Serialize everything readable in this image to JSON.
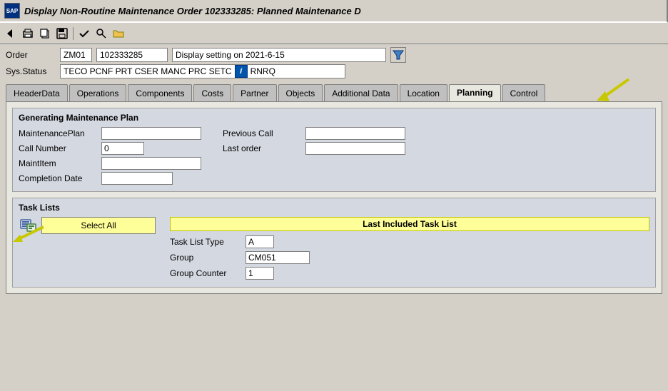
{
  "titlebar": {
    "title": "Display Non-Routine Maintenance Order 102333285: Planned Maintenance D",
    "icon_text": "SAP"
  },
  "toolbar": {
    "buttons": [
      "⬆",
      "🖨",
      "📋",
      "💾",
      "📂",
      "✂",
      "✔",
      "🔍"
    ]
  },
  "order": {
    "label": "Order",
    "type": "ZM01",
    "number": "102333285",
    "description": "Display setting on 2021-6-15"
  },
  "sys_status": {
    "label": "Sys.Status",
    "values": "TECO PCNF PRT   CSER MANC PRC   SETC",
    "extra": "RNRQ"
  },
  "tabs": [
    {
      "id": "headerdata",
      "label": "HeaderData"
    },
    {
      "id": "operations",
      "label": "Operations"
    },
    {
      "id": "components",
      "label": "Components"
    },
    {
      "id": "costs",
      "label": "Costs"
    },
    {
      "id": "partner",
      "label": "Partner"
    },
    {
      "id": "objects",
      "label": "Objects"
    },
    {
      "id": "additional-data",
      "label": "Additional Data"
    },
    {
      "id": "location",
      "label": "Location"
    },
    {
      "id": "planning",
      "label": "Planning"
    },
    {
      "id": "control",
      "label": "Control"
    }
  ],
  "active_tab": "planning",
  "planning": {
    "generating_section": {
      "title": "Generating Maintenance Plan",
      "fields_left": [
        {
          "label": "MaintenancePlan",
          "value": ""
        },
        {
          "label": "Call Number",
          "value": "0"
        },
        {
          "label": "MaintItem",
          "value": ""
        },
        {
          "label": "Completion Date",
          "value": ""
        }
      ],
      "fields_right": [
        {
          "label": "Previous Call",
          "value": ""
        },
        {
          "label": "Last order",
          "value": ""
        }
      ]
    },
    "task_lists": {
      "title": "Task Lists",
      "select_all_label": "Select All",
      "last_included_header": "Last Included Task List",
      "fields": [
        {
          "label": "Task List Type",
          "value": "A"
        },
        {
          "label": "Group",
          "value": "CM051"
        },
        {
          "label": "Group Counter",
          "value": "1"
        }
      ]
    }
  }
}
